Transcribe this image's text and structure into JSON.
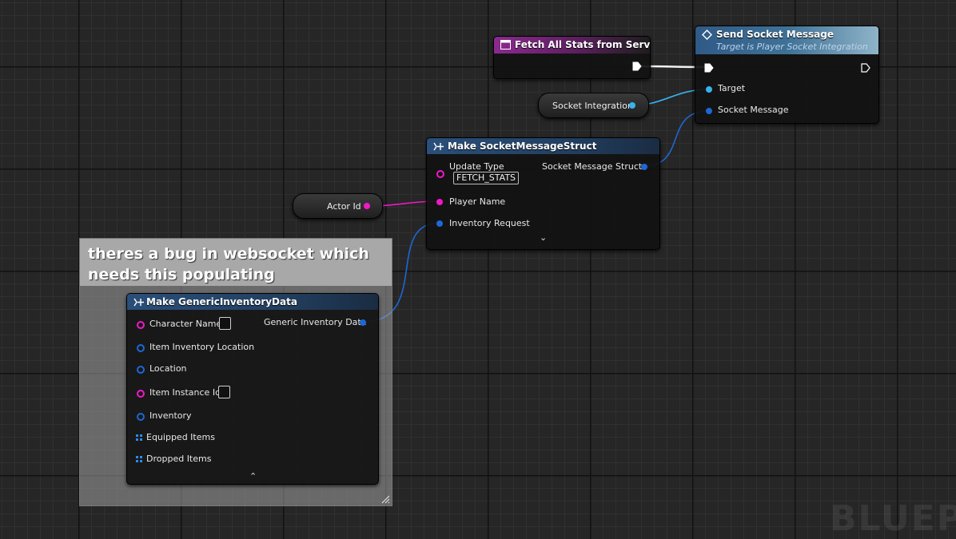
{
  "colors": {
    "exec": "#ffffff",
    "object_pin": "#36b3ee",
    "struct_pin": "#1c68d6",
    "string_pin": "#f018c8",
    "function_header": "#2f5a86",
    "event_header": "#8a2a8e"
  },
  "event_node": {
    "title": "Fetch All Stats from Server",
    "icon": "event-icon"
  },
  "send_node": {
    "title": "Send Socket Message",
    "subtitle": "Target is Player Socket Integration",
    "icon": "function-icon",
    "pins": {
      "target": "Target",
      "socket_message": "Socket Message"
    }
  },
  "socket_var": {
    "label": "Socket Integration"
  },
  "actor_var": {
    "label": "Actor Id"
  },
  "make_socket_node": {
    "title": "Make SocketMessageStruct",
    "icon": "make-struct-icon",
    "pins": {
      "update_type": "Update Type",
      "update_type_value": "FETCH_STATS",
      "player_name": "Player Name",
      "inventory_request": "Inventory Request",
      "output": "Socket Message Struct"
    },
    "expander": "⌄"
  },
  "comment": {
    "text": "theres a bug in websocket which needs this populating"
  },
  "make_inventory_node": {
    "title": "Make GenericInventoryData",
    "icon": "make-struct-icon",
    "pins": {
      "character_name": "Character Name",
      "item_inventory_location": "Item Inventory Location",
      "location": "Location",
      "item_instance_id": "Item Instance Id",
      "inventory": "Inventory",
      "equipped_items": "Equipped Items",
      "dropped_items": "Dropped Items",
      "output": "Generic Inventory Data"
    },
    "collapser": "⌃"
  },
  "watermark": "BLUEP"
}
